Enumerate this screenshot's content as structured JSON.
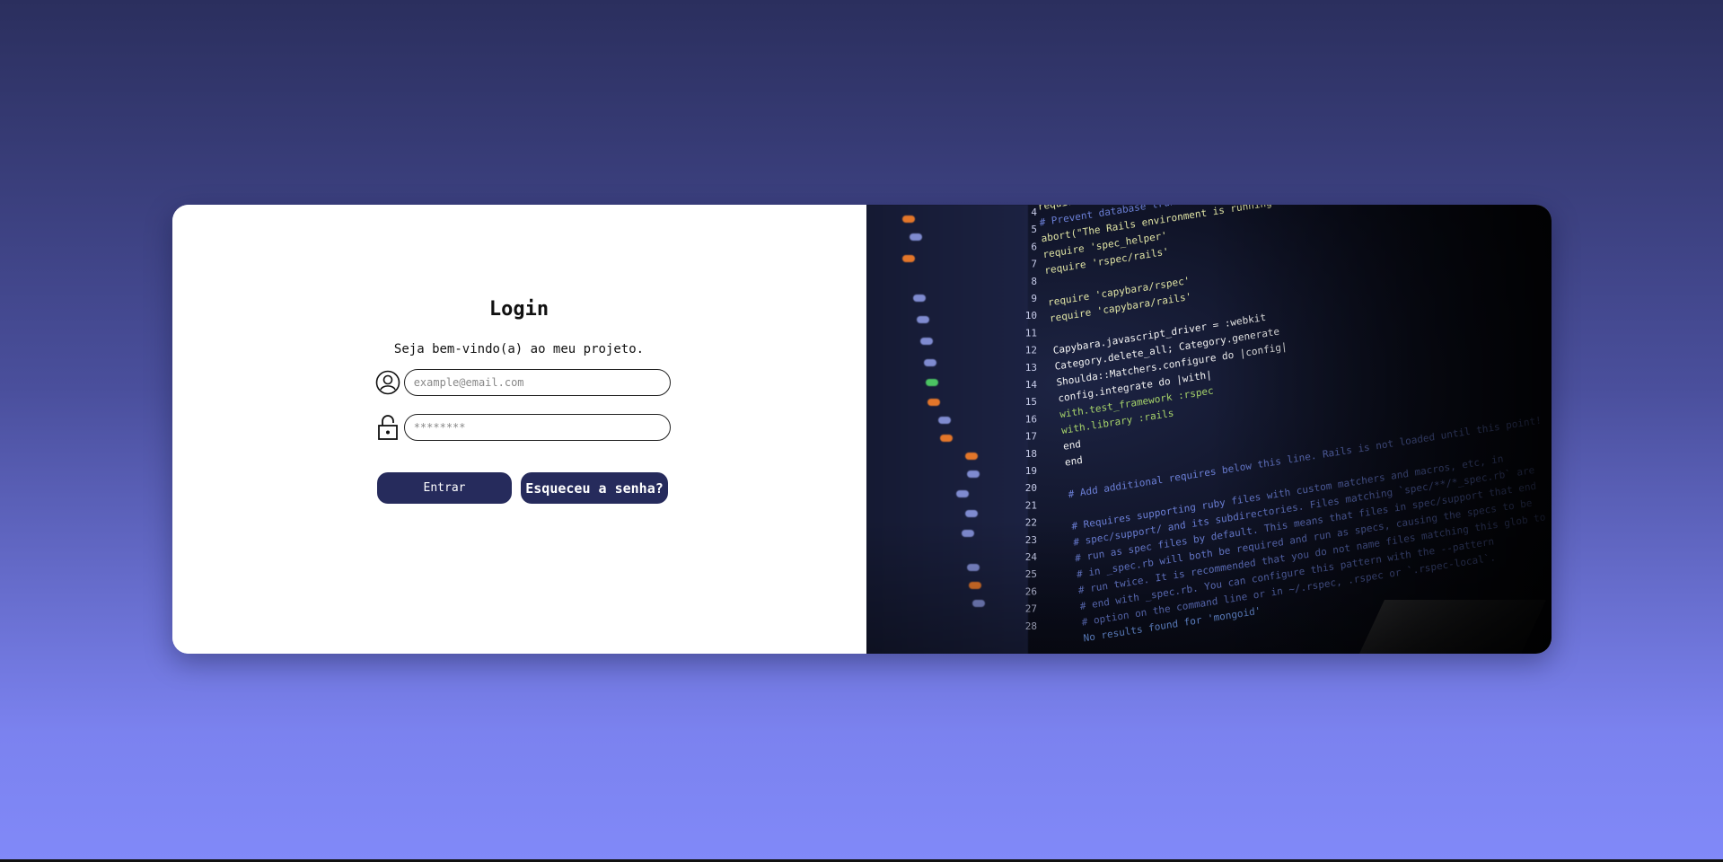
{
  "login": {
    "title": "Login",
    "subtitle": "Seja bem-vindo(a) ao meu projeto.",
    "email_placeholder": "example@email.com",
    "password_placeholder": "********",
    "enter_label": "Entrar",
    "forgot_label": "Esqueceu a senha?"
  },
  "photo": {
    "line_numbers": [
      "4",
      "5",
      "6",
      "7",
      "8",
      "9",
      "10",
      "11",
      "12",
      "13",
      "14",
      "15",
      "16",
      "17",
      "18",
      "19",
      "20",
      "21",
      "22",
      "23",
      "24",
      "25",
      "26",
      "27",
      "28"
    ],
    "code_lines": [
      "require File.expand_path('../../config/environment', __FILE__)",
      "# Prevent database truncation if the environment is production",
      "abort(\"The Rails environment is running in production mode!\")",
      "require 'spec_helper'",
      "require 'rspec/rails'",
      "",
      "require 'capybara/rspec'",
      "require 'capybara/rails'",
      "",
      "Capybara.javascript_driver = :webkit",
      "Category.delete_all; Category.generate",
      "Shoulda::Matchers.configure do |config|",
      "  config.integrate do |with|",
      "    with.test_framework :rspec",
      "    with.library :rails",
      "  end",
      "end",
      "",
      "# Add additional requires below this line. Rails is not loaded until this point!",
      "",
      "# Requires supporting ruby files with custom matchers and macros, etc, in",
      "# spec/support/ and its subdirectories. Files matching `spec/**/*_spec.rb` are",
      "# run as spec files by default. This means that files in spec/support that end",
      "# in _spec.rb will both be required and run as specs, causing the specs to be",
      "# run twice. It is recommended that you do not name files matching this glob to",
      "# end with _spec.rb. You can configure this pattern with the --pattern",
      "# option on the command line or in ~/.rspec, .rspec or `.rspec-local`.",
      "No results found for 'mongoid'"
    ]
  }
}
